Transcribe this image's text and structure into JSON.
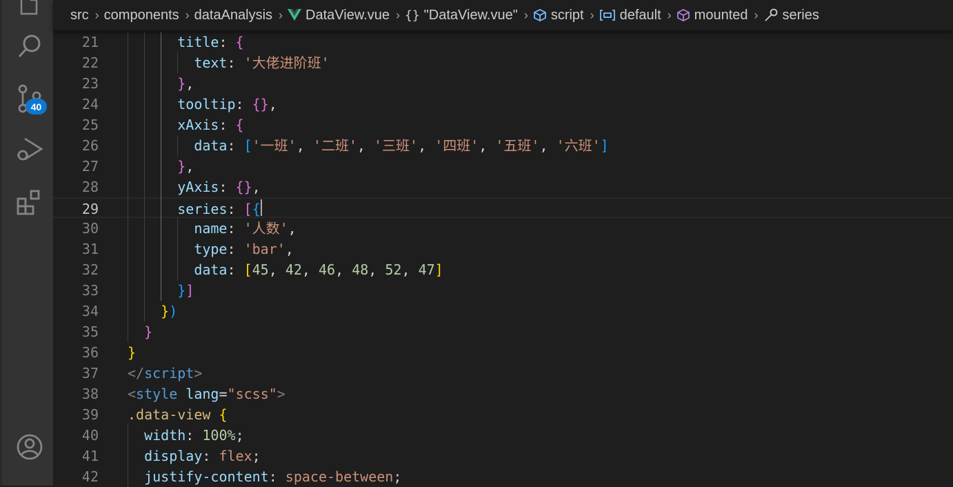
{
  "activity_bar": {
    "items": [
      {
        "name": "explorer",
        "icon": "files-icon"
      },
      {
        "name": "search",
        "icon": "search-icon"
      },
      {
        "name": "source-control",
        "icon": "source-control-icon",
        "badge": "40"
      },
      {
        "name": "run-and-debug",
        "icon": "run-debug-icon"
      },
      {
        "name": "extensions",
        "icon": "extensions-icon"
      }
    ],
    "bottom": {
      "name": "accounts",
      "icon": "account-icon"
    }
  },
  "breadcrumbs": [
    {
      "label": "src",
      "icon": null
    },
    {
      "label": "components",
      "icon": null
    },
    {
      "label": "dataAnalysis",
      "icon": null
    },
    {
      "label": "DataView.vue",
      "icon": "vue-icon"
    },
    {
      "label": "\"DataView.vue\"",
      "icon": "braces-icon"
    },
    {
      "label": "script",
      "icon": "module-icon"
    },
    {
      "label": "default",
      "icon": "variable-icon"
    },
    {
      "label": "mounted",
      "icon": "method-icon"
    },
    {
      "label": "series",
      "icon": "wrench-icon"
    }
  ],
  "editor": {
    "current_line": 29,
    "lines": [
      {
        "n": "21",
        "indent": 6,
        "tokens": [
          [
            "k",
            "title"
          ],
          [
            "p",
            ": "
          ],
          [
            "b2",
            "{"
          ]
        ]
      },
      {
        "n": "22",
        "indent": 8,
        "tokens": [
          [
            "k",
            "text"
          ],
          [
            "p",
            ": "
          ],
          [
            "s",
            "'大佬进阶班'"
          ]
        ]
      },
      {
        "n": "23",
        "indent": 6,
        "tokens": [
          [
            "b2",
            "}"
          ],
          [
            "p",
            ","
          ]
        ]
      },
      {
        "n": "24",
        "indent": 6,
        "tokens": [
          [
            "k",
            "tooltip"
          ],
          [
            "p",
            ": "
          ],
          [
            "b2",
            "{}"
          ],
          [
            "p",
            ","
          ]
        ]
      },
      {
        "n": "25",
        "indent": 6,
        "tokens": [
          [
            "k",
            "xAxis"
          ],
          [
            "p",
            ": "
          ],
          [
            "b2",
            "{"
          ]
        ]
      },
      {
        "n": "26",
        "indent": 8,
        "tokens": [
          [
            "k",
            "data"
          ],
          [
            "p",
            ": "
          ],
          [
            "b3",
            "["
          ],
          [
            "s",
            "'一班'"
          ],
          [
            "p",
            ", "
          ],
          [
            "s",
            "'二班'"
          ],
          [
            "p",
            ", "
          ],
          [
            "s",
            "'三班'"
          ],
          [
            "p",
            ", "
          ],
          [
            "s",
            "'四班'"
          ],
          [
            "p",
            ", "
          ],
          [
            "s",
            "'五班'"
          ],
          [
            "p",
            ", "
          ],
          [
            "s",
            "'六班'"
          ],
          [
            "b3",
            "]"
          ]
        ]
      },
      {
        "n": "27",
        "indent": 6,
        "tokens": [
          [
            "b2",
            "}"
          ],
          [
            "p",
            ","
          ]
        ]
      },
      {
        "n": "28",
        "indent": 6,
        "tokens": [
          [
            "k",
            "yAxis"
          ],
          [
            "p",
            ": "
          ],
          [
            "b2",
            "{}"
          ],
          [
            "p",
            ","
          ]
        ]
      },
      {
        "n": "29",
        "indent": 6,
        "tokens": [
          [
            "k",
            "series"
          ],
          [
            "p",
            ": "
          ],
          [
            "b2",
            "["
          ],
          [
            "b3",
            "{"
          ]
        ]
      },
      {
        "n": "30",
        "indent": 8,
        "tokens": [
          [
            "k",
            "name"
          ],
          [
            "p",
            ": "
          ],
          [
            "s",
            "'人数'"
          ],
          [
            "p",
            ","
          ]
        ]
      },
      {
        "n": "31",
        "indent": 8,
        "tokens": [
          [
            "k",
            "type"
          ],
          [
            "p",
            ": "
          ],
          [
            "s",
            "'bar'"
          ],
          [
            "p",
            ","
          ]
        ]
      },
      {
        "n": "32",
        "indent": 8,
        "tokens": [
          [
            "k",
            "data"
          ],
          [
            "p",
            ": "
          ],
          [
            "b1",
            "["
          ],
          [
            "n",
            "45"
          ],
          [
            "p",
            ", "
          ],
          [
            "n",
            "42"
          ],
          [
            "p",
            ", "
          ],
          [
            "n",
            "46"
          ],
          [
            "p",
            ", "
          ],
          [
            "n",
            "48"
          ],
          [
            "p",
            ", "
          ],
          [
            "n",
            "52"
          ],
          [
            "p",
            ", "
          ],
          [
            "n",
            "47"
          ],
          [
            "b1",
            "]"
          ]
        ]
      },
      {
        "n": "33",
        "indent": 6,
        "tokens": [
          [
            "b3",
            "}"
          ],
          [
            "b2",
            "]"
          ]
        ]
      },
      {
        "n": "34",
        "indent": 4,
        "tokens": [
          [
            "b1",
            "}"
          ],
          [
            "b3",
            ")"
          ]
        ]
      },
      {
        "n": "35",
        "indent": 2,
        "tokens": [
          [
            "b2",
            "}"
          ]
        ]
      },
      {
        "n": "36",
        "indent": 0,
        "tokens": [
          [
            "b1",
            "}"
          ]
        ]
      },
      {
        "n": "37",
        "indent": 0,
        "tokens": [
          [
            "ang",
            "</"
          ],
          [
            "tg",
            "script"
          ],
          [
            "ang",
            ">"
          ]
        ]
      },
      {
        "n": "38",
        "indent": 0,
        "tokens": [
          [
            "ang",
            "<"
          ],
          [
            "tg",
            "style"
          ],
          [
            "p",
            " "
          ],
          [
            "k",
            "lang"
          ],
          [
            "p",
            "="
          ],
          [
            "s",
            "\"scss\""
          ],
          [
            "ang",
            ">"
          ]
        ]
      },
      {
        "n": "39",
        "indent": 0,
        "tokens": [
          [
            "sel",
            ".data-view"
          ],
          [
            "p",
            " "
          ],
          [
            "b1",
            "{"
          ]
        ]
      },
      {
        "n": "40",
        "indent": 2,
        "tokens": [
          [
            "k",
            "width"
          ],
          [
            "p",
            ": "
          ],
          [
            "n",
            "100%"
          ],
          [
            "p",
            ";"
          ]
        ]
      },
      {
        "n": "41",
        "indent": 2,
        "tokens": [
          [
            "k",
            "display"
          ],
          [
            "p",
            ": "
          ],
          [
            "s",
            "flex"
          ],
          [
            "p",
            ";"
          ]
        ]
      },
      {
        "n": "42",
        "indent": 2,
        "tokens": [
          [
            "k",
            "justify-content"
          ],
          [
            "p",
            ": "
          ],
          [
            "s",
            "space-between"
          ],
          [
            "p",
            ";"
          ]
        ]
      }
    ]
  }
}
